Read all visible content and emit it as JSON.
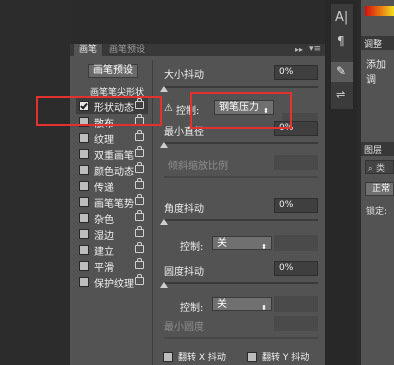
{
  "tabs": [
    "画笔",
    "画笔预设"
  ],
  "preset_button": "画笔预设",
  "brush_tip_shape": "画笔笔尖形状",
  "options": [
    {
      "label": "形状动态",
      "checked": true
    },
    {
      "label": "散布",
      "checked": false
    },
    {
      "label": "纹理",
      "checked": false
    },
    {
      "label": "双重画笔",
      "checked": false
    },
    {
      "label": "颜色动态",
      "checked": false
    },
    {
      "label": "传递",
      "checked": false
    },
    {
      "label": "画笔笔势",
      "checked": false
    },
    {
      "label": "杂色",
      "checked": false
    },
    {
      "label": "湿边",
      "checked": false
    },
    {
      "label": "建立",
      "checked": false
    },
    {
      "label": "平滑",
      "checked": false
    },
    {
      "label": "保护纹理",
      "checked": false
    }
  ],
  "size_jitter": {
    "label": "大小抖动",
    "value": "0%",
    "level": 0
  },
  "control_1": {
    "label": "控制:",
    "value": "钢笔压力",
    "warning": "⚠"
  },
  "min_diameter": {
    "label": "最小直径",
    "value": "0%",
    "level": 0
  },
  "tilt_scale": {
    "label": "倾斜缩放比例"
  },
  "angle_jitter": {
    "label": "角度抖动",
    "value": "0%",
    "level": 0
  },
  "control_2": {
    "label": "控制:",
    "value": "关"
  },
  "roundness_jitter": {
    "label": "圆度抖动",
    "value": "0%",
    "level": 0
  },
  "control_3": {
    "label": "控制:",
    "value": "关"
  },
  "min_roundness": {
    "label": "最小圆度"
  },
  "flip_x": "翻转 X 抖动",
  "flip_y": "翻转 Y 抖动",
  "right_panel": {
    "adjust_tab": "调整",
    "add_adjust": "添加调",
    "layers_tab": "图层",
    "kind": "类",
    "normal": "正常",
    "lock": "锁定:"
  },
  "colors": {
    "accent_red": "#e3312d"
  }
}
